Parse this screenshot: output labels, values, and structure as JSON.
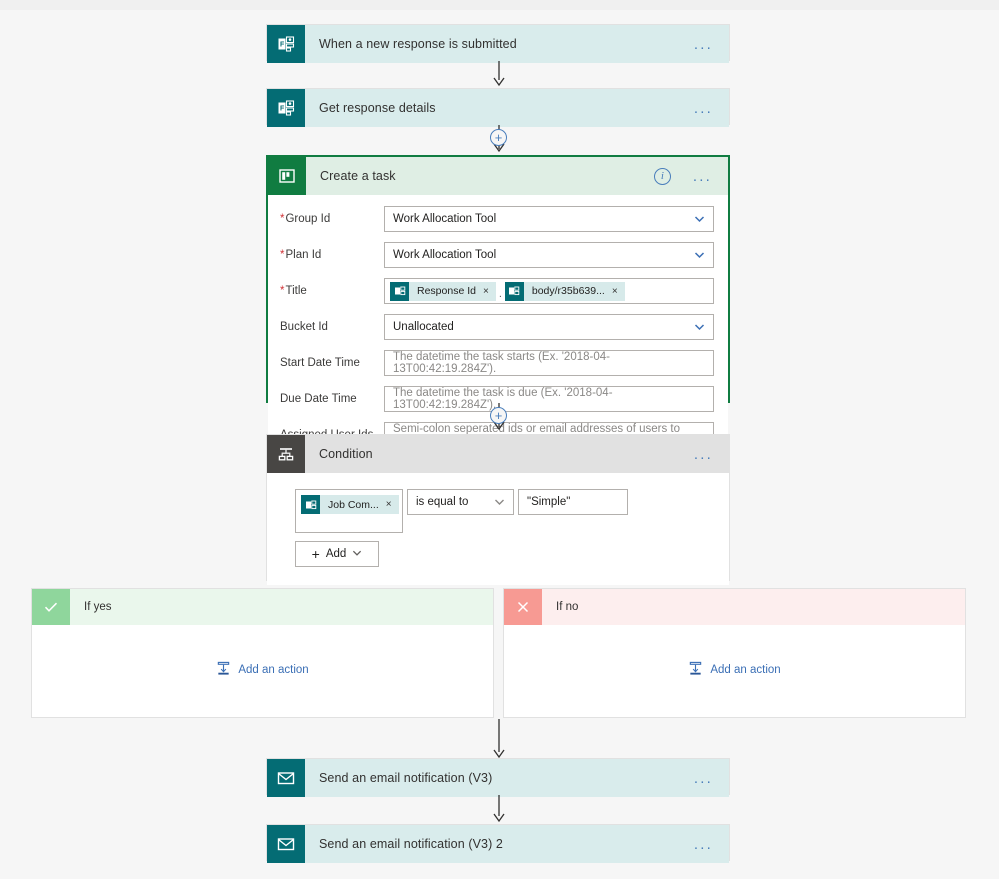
{
  "canvas": {
    "background": "#f6f6f6"
  },
  "colors": {
    "forms_teal": "#046c74",
    "planner_green": "#107c41",
    "condition_dark": "#484644",
    "link_blue": "#3b6fb5",
    "yes_green": "#8fd69c",
    "no_red": "#f79a93",
    "required_red": "#d13438"
  },
  "steps": {
    "trigger": {
      "title": "When a new response is submitted",
      "icon": "microsoft-forms-icon",
      "menu": "..."
    },
    "get_response": {
      "title": "Get response details",
      "icon": "microsoft-forms-icon",
      "menu": "..."
    },
    "create_task": {
      "title": "Create a task",
      "icon": "microsoft-planner-icon",
      "menu": "...",
      "info": "i",
      "fields": [
        {
          "label": "Group Id",
          "required": true,
          "type": "dropdown",
          "value": "Work Allocation Tool",
          "placeholder": ""
        },
        {
          "label": "Plan Id",
          "required": true,
          "type": "dropdown",
          "value": "Work Allocation Tool",
          "placeholder": ""
        },
        {
          "label": "Title",
          "required": true,
          "type": "tokens",
          "value": "",
          "placeholder": ""
        },
        {
          "label": "Bucket Id",
          "required": false,
          "type": "dropdown",
          "value": "Unallocated",
          "placeholder": ""
        },
        {
          "label": "Start Date Time",
          "required": false,
          "type": "text",
          "value": "",
          "placeholder": "The datetime the task starts (Ex. '2018-04-13T00:42:19.284Z')."
        },
        {
          "label": "Due Date Time",
          "required": false,
          "type": "text",
          "value": "",
          "placeholder": "The datetime the task is due (Ex. '2018-04-13T00:42:19.284Z')."
        },
        {
          "label": "Assigned User Ids",
          "required": false,
          "type": "text",
          "value": "",
          "placeholder": "Semi-colon seperated ids or email addresses of users to assign this task to."
        }
      ],
      "title_tokens": [
        {
          "text": "Response Id",
          "remove": "×",
          "icon": "forms-token-icon"
        },
        {
          "text": "body/r35b639...",
          "remove": "×",
          "icon": "forms-token-icon"
        }
      ],
      "token_separator": "."
    },
    "condition": {
      "title": "Condition",
      "icon": "condition-branch-icon",
      "menu": "...",
      "left_token": {
        "text": "Job Com...",
        "remove": "×",
        "icon": "forms-token-icon"
      },
      "operator": "is equal to",
      "value": "\"Simple\"",
      "add_label": "Add",
      "add_plus": "+"
    },
    "if_yes": {
      "label": "If yes",
      "icon": "checkmark-icon",
      "add_action": "Add an action"
    },
    "if_no": {
      "label": "If no",
      "icon": "cross-icon",
      "add_action": "Add an action"
    },
    "email_1": {
      "title": "Send an email notification (V3)",
      "icon": "email-icon",
      "menu": "..."
    },
    "email_2": {
      "title": "Send an email notification (V3) 2",
      "icon": "email-icon",
      "menu": "..."
    }
  },
  "connectors": {
    "insert_plus": "+"
  }
}
